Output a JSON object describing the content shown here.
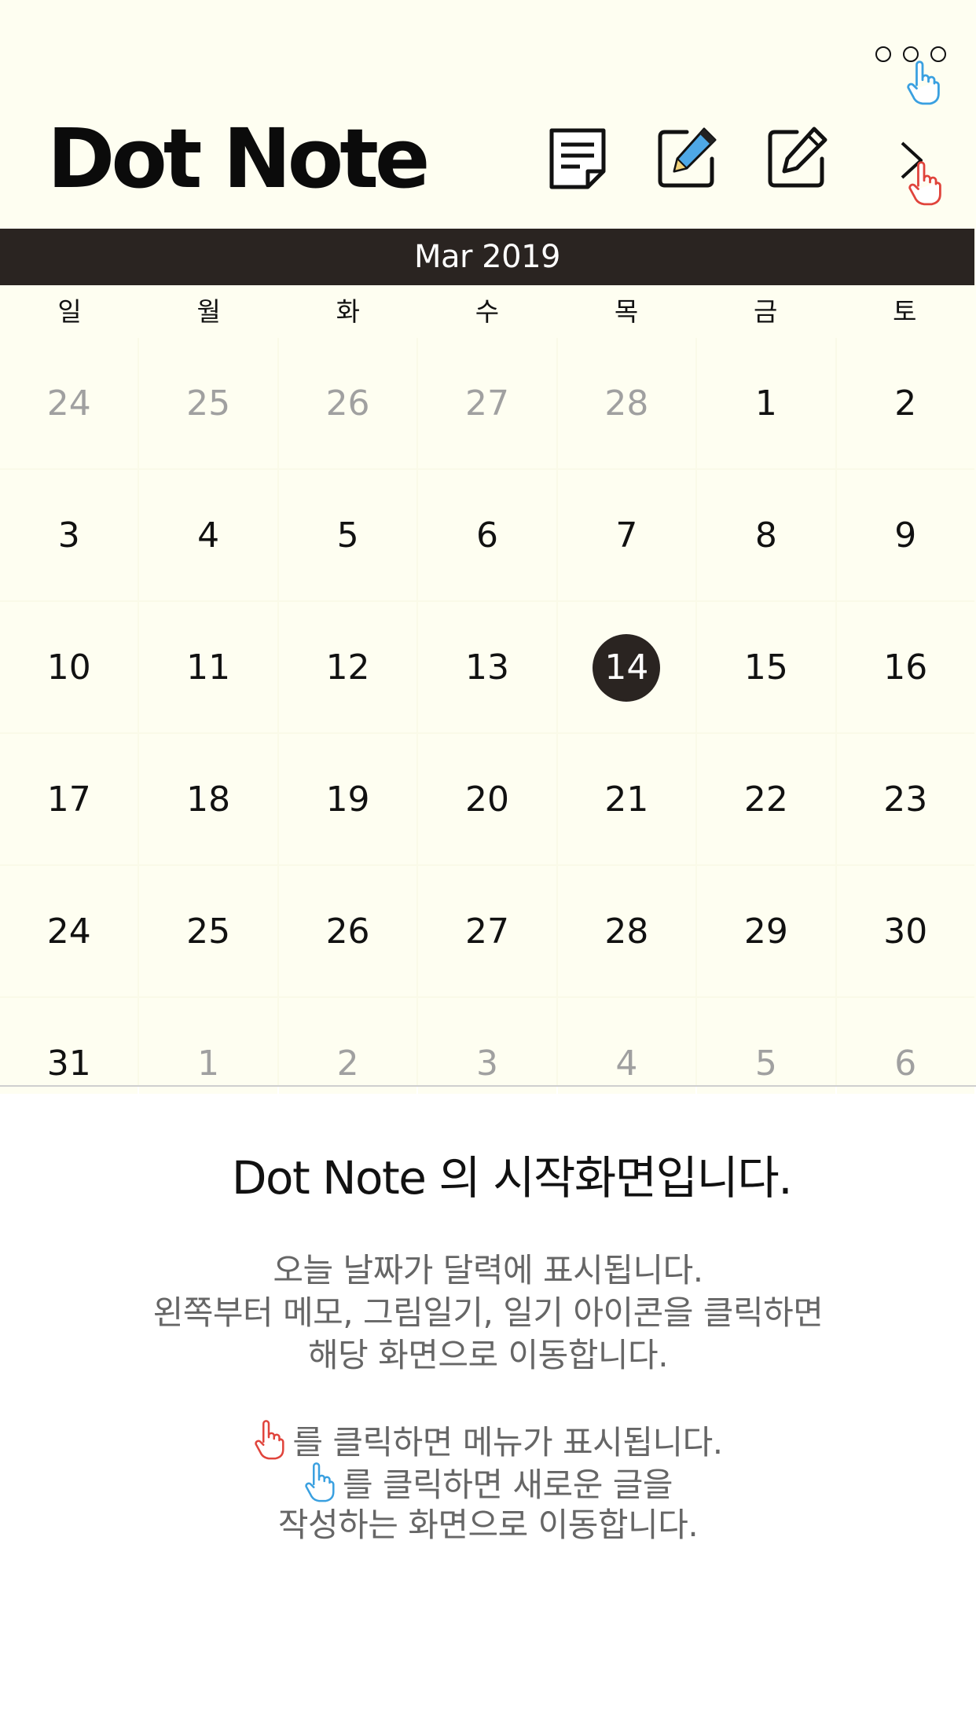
{
  "app": {
    "title": "Dot Note"
  },
  "toolbar": {
    "memo_icon": "memo-note-icon",
    "drawing_icon": "drawing-pencil-icon",
    "diary_icon": "diary-edit-icon",
    "next_icon": "chevron-right-icon",
    "more_icon": "more-dots-icon"
  },
  "calendar": {
    "month_label": "Mar 2019",
    "weekdays": [
      "일",
      "월",
      "화",
      "수",
      "목",
      "금",
      "토"
    ],
    "days": [
      "24",
      "25",
      "26",
      "27",
      "28",
      "1",
      "2",
      "3",
      "4",
      "5",
      "6",
      "7",
      "8",
      "9",
      "10",
      "11",
      "12",
      "13",
      "14",
      "15",
      "16",
      "17",
      "18",
      "19",
      "20",
      "21",
      "22",
      "23",
      "24",
      "25",
      "26",
      "27",
      "28",
      "29",
      "30",
      "31",
      "1",
      "2",
      "3",
      "4",
      "5",
      "6"
    ],
    "today": "14"
  },
  "guide": {
    "heading": "Dot Note 의 시작화면입니다.",
    "line1": "오늘 날짜가 달력에 표시됩니다.",
    "line2": "왼쪽부터 메모, 그림일기, 일기 아이콘을 클릭하면",
    "line3": "해당 화면으로 이동합니다.",
    "line4": "를 클릭하면 메뉴가 표시됩니다.",
    "line5": "를 클릭하면 새로운 글을",
    "line6": "작성하는 화면으로 이동합니다."
  },
  "colors": {
    "background_top": "#fefef1",
    "month_bar": "#2a2421",
    "other_month_text": "#a0a0a0",
    "hand_red": "#e0443c",
    "hand_blue": "#3aa0e0",
    "pencil_blue": "#4ea8e6"
  }
}
